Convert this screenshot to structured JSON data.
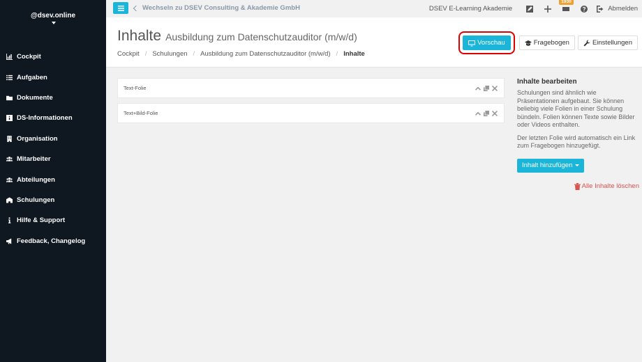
{
  "sidebar": {
    "user": "@dsev.online",
    "items": [
      {
        "label": "Cockpit",
        "icon": "chart-icon"
      },
      {
        "label": "Aufgaben",
        "icon": "list-icon"
      },
      {
        "label": "Dokumente",
        "icon": "folder-icon"
      },
      {
        "label": "DS-Informationen",
        "icon": "info-icon"
      },
      {
        "label": "Organisation",
        "icon": "building-icon"
      },
      {
        "label": "Mitarbeiter",
        "icon": "users-icon"
      },
      {
        "label": "Abteilungen",
        "icon": "users-icon"
      },
      {
        "label": "Schulungen",
        "icon": "school-icon"
      },
      {
        "label": "Hilfe & Support",
        "icon": "info-icon"
      },
      {
        "label": "Feedback, Changelog",
        "icon": "megaphone-icon"
      }
    ]
  },
  "topbar": {
    "switch_label": "Wechseln zu DSEV Consulting & Akademie GmbH",
    "org_name": "DSEV E-Learning Akademie",
    "badge_count": "1930",
    "logout_label": "Abmelden"
  },
  "header": {
    "title": "Inhalte",
    "subtitle": "Ausbildung zum Datenschutzauditor (m/w/d)",
    "breadcrumb": [
      "Cockpit",
      "Schulungen",
      "Ausbildung zum Datenschutzauditor (m/w/d)",
      "Inhalte"
    ],
    "buttons": {
      "preview": "Vorschau",
      "questionnaire": "Fragebogen",
      "settings": "Einstellungen"
    }
  },
  "slides": [
    {
      "label": "Text-Folie"
    },
    {
      "label": "Text+Bild-Folie"
    }
  ],
  "panel": {
    "heading": "Inhalte bearbeiten",
    "paragraph1": "Schulungen sind ähnlich wie Präsentationen aufgebaut. Sie können beliebig viele Folien in einer Schulung bündeln. Folien können Texte sowie Bilder oder Videos enthalten.",
    "paragraph2": "Der letzten Folie wird automatisch ein Link zum Fragebogen hinzugefügt.",
    "add_button": "Inhalt hinzufügen",
    "delete_all": "Alle Inhalte löschen"
  },
  "colors": {
    "accent": "#1ab5d9",
    "sidebar_bg": "#0f1720",
    "danger": "#d9534f",
    "badge": "#f0a030",
    "highlight": "#e00000"
  }
}
